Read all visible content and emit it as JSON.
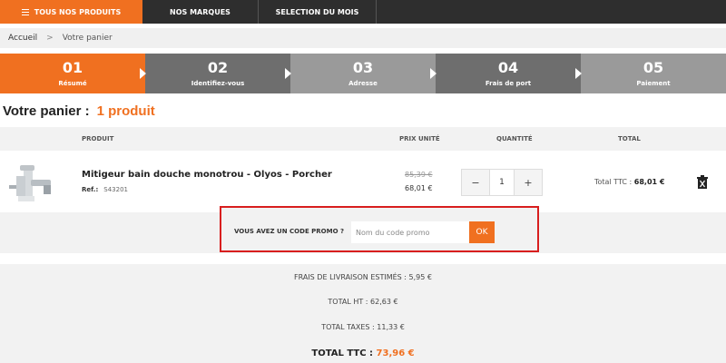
{
  "nav": {
    "items": [
      "TOUS NOS PRODUITS",
      "NOS MARQUES",
      "SELECTION DU MOIS"
    ],
    "accent": "#f07020"
  },
  "breadcrumb": {
    "home": "Accueil",
    "separator": ">",
    "current": "Votre panier"
  },
  "steps": [
    {
      "num": "01",
      "label": "Résumé",
      "state": "active"
    },
    {
      "num": "02",
      "label": "Identifiez-vous",
      "state": "dark"
    },
    {
      "num": "03",
      "label": "Adresse",
      "state": "light"
    },
    {
      "num": "04",
      "label": "Frais de port",
      "state": "dark"
    },
    {
      "num": "05",
      "label": "Paiement",
      "state": "light"
    }
  ],
  "cart": {
    "title": "Votre panier :",
    "count": "1 produit"
  },
  "table": {
    "headers": {
      "product": "PRODUIT",
      "unit_price": "PRIX UNITÉ",
      "quantity": "QUANTITÉ",
      "total": "TOTAL"
    },
    "row": {
      "name": "Mitigeur bain douche monotrou - Olyos - Porcher",
      "ref_label": "Ref.:",
      "ref": "S43201",
      "old_price": "85,39 €",
      "price": "68,01 €",
      "minus": "−",
      "qty": "1",
      "plus": "+",
      "total_label": "Total TTC :",
      "total": "68,01 €",
      "delete_icon": "trash-icon",
      "product_icon": "faucet-icon"
    }
  },
  "promo": {
    "label": "VOUS AVEZ UN CODE PROMO ?",
    "placeholder": "Nom du code promo",
    "ok": "OK"
  },
  "totals": {
    "shipping": "FRAIS DE LIVRAISON ESTIMÉS : 5,95 €",
    "total_ht": "TOTAL HT : 62,63 €",
    "taxes": "TOTAL TAXES : 11,33 €",
    "ttc_label": "TOTAL TTC :",
    "ttc_amount": "73,96 €"
  }
}
